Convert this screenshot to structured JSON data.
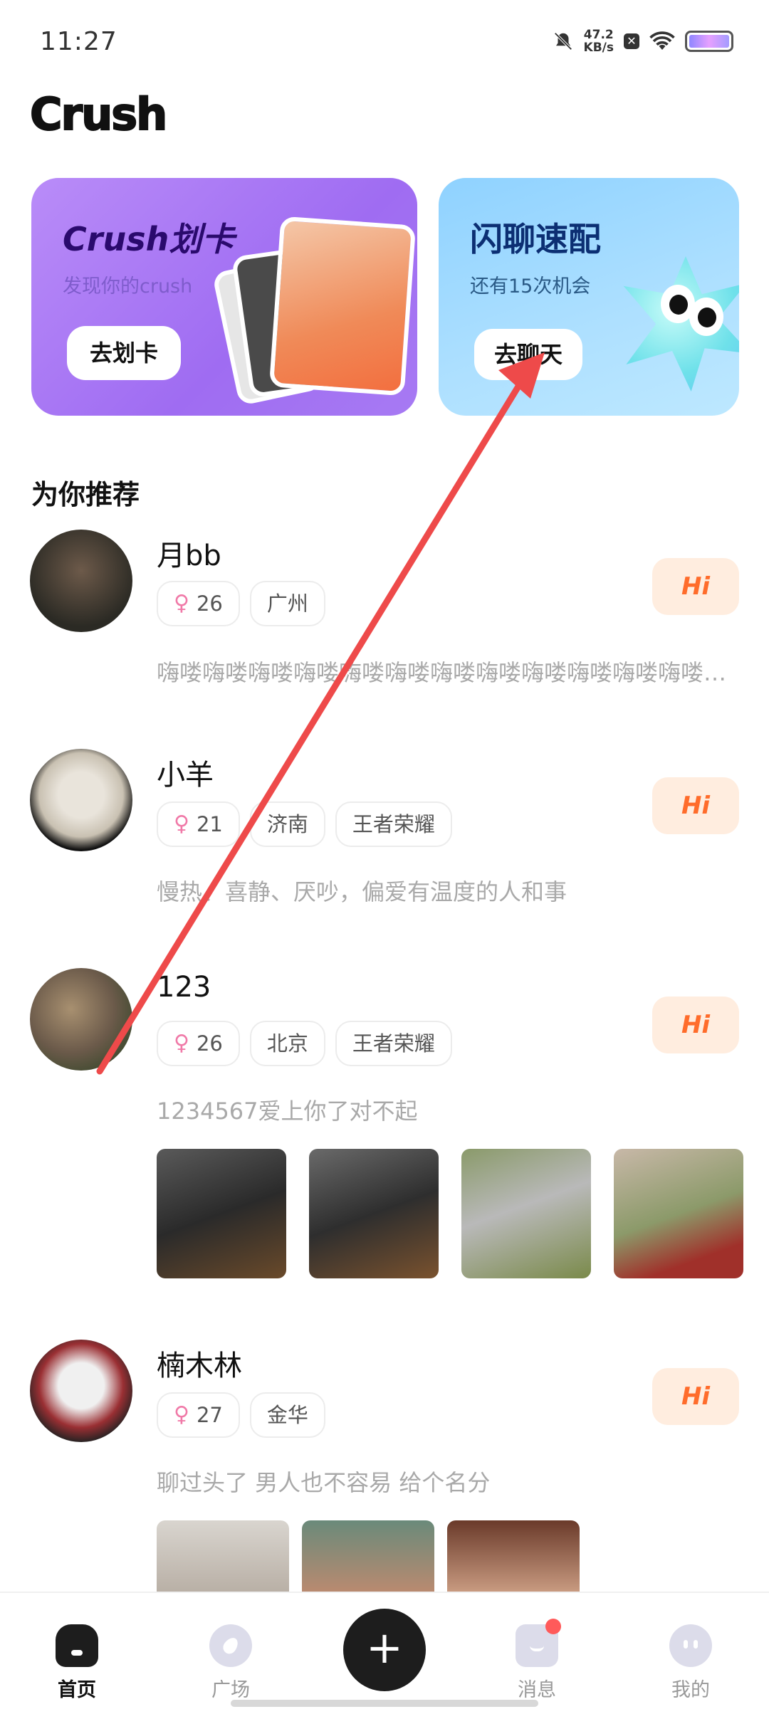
{
  "status_bar": {
    "time": "11:27",
    "net_speed_value": "47.2",
    "net_speed_unit": "KB/s",
    "icons": [
      "bell-off-icon",
      "close-box-icon",
      "wifi-icon",
      "battery-icon"
    ]
  },
  "app": {
    "logo_text": "Crush"
  },
  "promo_cards": [
    {
      "title": "Crush划卡",
      "subtitle": "发现你的crush",
      "button": "去划卡"
    },
    {
      "title": "闪聊速配",
      "subtitle": "还有15次机会",
      "button": "去聊天"
    }
  ],
  "section": {
    "recommend_title": "为你推荐"
  },
  "feed": [
    {
      "name": "月bb",
      "age": "26",
      "tags": [
        "广州"
      ],
      "bio": "嗨喽嗨喽嗨喽嗨喽嗨喽嗨喽嗨喽嗨喽嗨喽嗨喽嗨喽嗨喽嗨喽嗨喽",
      "hi": "Hi"
    },
    {
      "name": "小羊",
      "age": "21",
      "tags": [
        "济南",
        "王者荣耀"
      ],
      "bio": "慢热、喜静、厌吵，偏爱有温度的人和事",
      "hi": "Hi"
    },
    {
      "name": "123",
      "age": "26",
      "tags": [
        "北京",
        "王者荣耀"
      ],
      "bio": "1234567爱上你了对不起",
      "hi": "Hi"
    },
    {
      "name": "楠木林",
      "age": "27",
      "tags": [
        "金华"
      ],
      "bio": "聊过头了 男人也不容易 给个名分",
      "hi": "Hi"
    }
  ],
  "bottom_nav": {
    "home": "首页",
    "square": "广场",
    "add": "+",
    "messages": "消息",
    "mine": "我的"
  },
  "colors": {
    "swipe_card": "#a877f4",
    "chat_card": "#9fd9ff",
    "hi_bg": "#ffeddf",
    "hi_text": "#ff6c2b",
    "annotation_arrow": "#ee4a4a"
  }
}
